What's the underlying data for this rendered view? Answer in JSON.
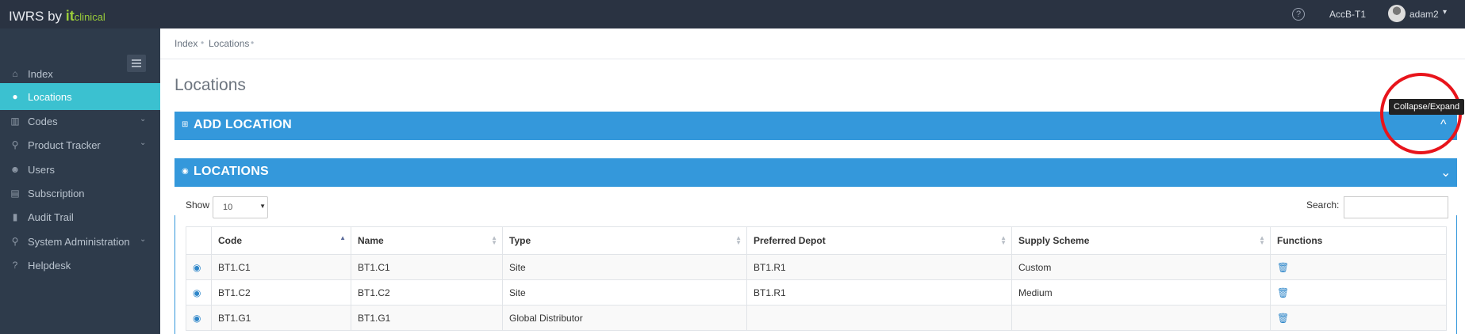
{
  "app": {
    "brand_prefix": "IWRS by ",
    "brand_it": "it",
    "brand_clinical": "clinical"
  },
  "topbar": {
    "help_icon": "question-circle-icon",
    "study": "AccB-T1",
    "user": "adam2",
    "user_caret": "▾"
  },
  "sidebar": {
    "items": [
      {
        "label": "Index",
        "icon": "home-icon",
        "glyph": "⌂",
        "chevron": ""
      },
      {
        "label": "Locations",
        "icon": "globe-icon",
        "glyph": "●",
        "chevron": ""
      },
      {
        "label": "Codes",
        "icon": "barcode-icon",
        "glyph": "▥",
        "chevron": "⌄"
      },
      {
        "label": "Product Tracker",
        "icon": "map-marker-icon",
        "glyph": "⚲",
        "chevron": "⌄"
      },
      {
        "label": "Users",
        "icon": "users-icon",
        "glyph": "☻",
        "chevron": ""
      },
      {
        "label": "Subscription",
        "icon": "list-icon",
        "glyph": "▤",
        "chevron": ""
      },
      {
        "label": "Audit Trail",
        "icon": "book-icon",
        "glyph": "▮",
        "chevron": ""
      },
      {
        "label": "System Administration",
        "icon": "map-marker-icon",
        "glyph": "⚲",
        "chevron": "⌄"
      },
      {
        "label": "Helpdesk",
        "icon": "question-icon",
        "glyph": "?",
        "chevron": ""
      }
    ],
    "active_color": "#3bc1d0"
  },
  "breadcrumb": {
    "items": [
      "Index",
      "Locations"
    ],
    "sep": "•"
  },
  "page": {
    "title": "Locations"
  },
  "panels": {
    "add": {
      "title": "ADD LOCATION",
      "icon": "⊞",
      "chevron": "^"
    },
    "list": {
      "title": "LOCATIONS",
      "icon": "◉",
      "chevron": "⌄"
    }
  },
  "table_controls": {
    "show_label": "Show",
    "show_value": "10",
    "search_label": "Search:"
  },
  "table": {
    "headers": [
      "",
      "Code",
      "Name",
      "Type",
      "Preferred Depot",
      "Supply Scheme",
      "Functions"
    ],
    "rows": [
      {
        "code": "BT1.C1",
        "name": "BT1.C1",
        "type": "Site",
        "depot": "BT1.R1",
        "scheme": "Custom"
      },
      {
        "code": "BT1.C2",
        "name": "BT1.C2",
        "type": "Site",
        "depot": "BT1.R1",
        "scheme": "Medium"
      },
      {
        "code": "BT1.G1",
        "name": "BT1.G1",
        "type": "Global Distributor",
        "depot": "",
        "scheme": ""
      }
    ]
  },
  "tooltip": {
    "text": "Collapse/Expand"
  },
  "colors": {
    "topbar": "#2a3342",
    "sidebar": "#2e3b4b",
    "panel_header": "#3498db",
    "annotation_circle": "#e8141b"
  }
}
